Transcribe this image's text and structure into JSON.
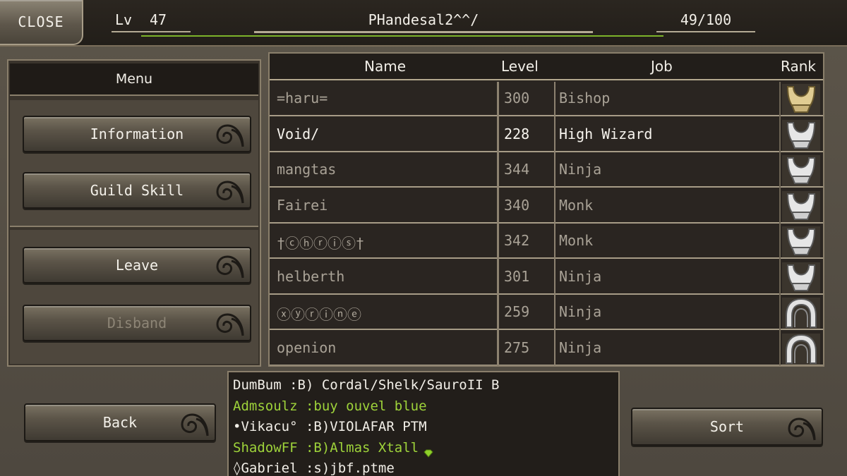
{
  "header": {
    "close_label": "CLOSE",
    "level_label": "Lv",
    "level_value": "47",
    "player_name": "PHandesal2^^/",
    "member_count": "49/100"
  },
  "menu": {
    "title": "Menu",
    "information_label": "Information",
    "guild_skill_label": "Guild Skill",
    "leave_label": "Leave",
    "disband_label": "Disband"
  },
  "table": {
    "headers": {
      "name": "Name",
      "level": "Level",
      "job": "Job",
      "rank": "Rank"
    },
    "rows": [
      {
        "name": "=haru=",
        "level": "300",
        "job": "Bishop",
        "rank_icon": "gold-rank-emblem-icon",
        "active": false
      },
      {
        "name": "Void/",
        "level": "228",
        "job": "High Wizard",
        "rank_icon": "silver-rank-emblem-icon",
        "active": true
      },
      {
        "name": "mangtas",
        "level": "344",
        "job": "Ninja",
        "rank_icon": "silver-rank-emblem-icon",
        "active": false
      },
      {
        "name": "Fairei",
        "level": "340",
        "job": "Monk",
        "rank_icon": "silver-rank-emblem-icon",
        "active": false
      },
      {
        "name": "†ⓒⓗⓡⓘⓢ†",
        "level": "342",
        "job": "Monk",
        "rank_icon": "silver-rank-emblem-icon",
        "active": false
      },
      {
        "name": "helberth",
        "level": "301",
        "job": "Ninja",
        "rank_icon": "silver-rank-emblem-icon",
        "active": false
      },
      {
        "name": "ⓧⓨⓡⓘⓝⓔ",
        "level": "259",
        "job": "Ninja",
        "rank_icon": "arch-rank-emblem-icon",
        "active": false
      },
      {
        "name": "openion",
        "level": "275",
        "job": "Ninja",
        "rank_icon": "arch-rank-emblem-icon",
        "active": false
      }
    ]
  },
  "bottom": {
    "back_label": "Back",
    "sort_label": "Sort"
  },
  "chat": {
    "lines": [
      {
        "text": "DumBum :B) Cordal/Shelk/SauroII B",
        "color": "#f2efe8"
      },
      {
        "text": "Admsoulz :buy ouvel blue",
        "color": "#9ed33a"
      },
      {
        "text": "•Vikacu° :B)VIOLAFAR PTM",
        "color": "#f2efe8"
      },
      {
        "text": "ShadowFF :B)Almas Xtall",
        "color": "#9ed33a",
        "icon": "green-gem-icon"
      },
      {
        "text": "◊Gabriel :s)jbf.ptme",
        "color": "#f2efe8"
      }
    ]
  },
  "colors": {
    "exp_bar": "#7db32a",
    "chat_highlight": "#9ed33a"
  }
}
